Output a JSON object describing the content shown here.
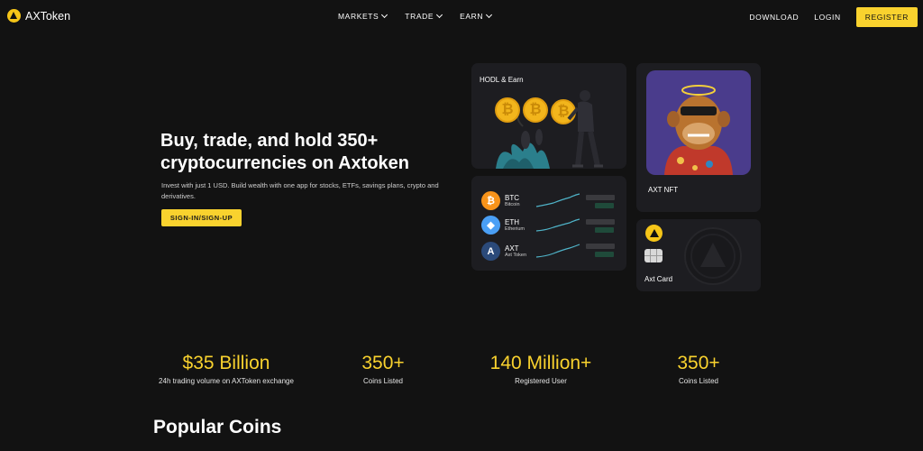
{
  "nav": {
    "logo_text": "AXToken",
    "menu": [
      {
        "label": "MARKETS"
      },
      {
        "label": "TRADE"
      },
      {
        "label": "EARN"
      }
    ],
    "download": "DOWNLOAD",
    "login": "LOGIN",
    "register": "REGISTER"
  },
  "hero": {
    "title_line1": "Buy, trade, and hold 350+",
    "title_line2": "cryptocurrencies on Axtoken",
    "subtitle": "Invest with just 1 USD. Build wealth with one app for stocks, ETFs, savings plans, crypto and derivatives.",
    "cta": "SIGN-IN/SIGN-UP"
  },
  "cards": {
    "hodl_label": "HODL & Earn",
    "nft_label": "AXT NFT",
    "card_label": "Axt Card",
    "coins": [
      {
        "symbol": "BTC",
        "name": "Bitcoin",
        "color": "#f7931a",
        "glyph": "₿"
      },
      {
        "symbol": "ETH",
        "name": "Etherium",
        "color": "#4a9ff5",
        "glyph": "◆"
      },
      {
        "symbol": "AXT",
        "name": "Axt Token",
        "color": "#2b4a7a",
        "glyph": "A"
      }
    ]
  },
  "stats": [
    {
      "value": "$35 Billion",
      "label": "24h trading volume on AXToken exchange"
    },
    {
      "value": "350+",
      "label": "Coins Listed"
    },
    {
      "value": "140 Million+",
      "label": "Registered User"
    },
    {
      "value": "350+",
      "label": "Coins Listed"
    }
  ],
  "section_title": "Popular Coins",
  "colors": {
    "accent": "#f9d22e",
    "background": "#121212",
    "card": "#1d1d21"
  }
}
